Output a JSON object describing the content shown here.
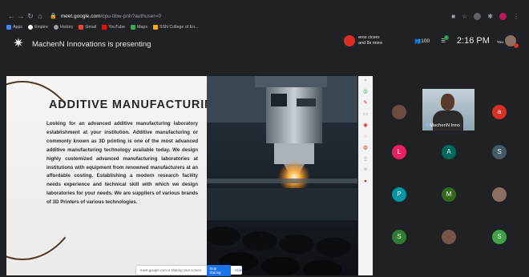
{
  "browser": {
    "nav_icons": [
      "back-icon",
      "forward-icon",
      "reload-icon",
      "home-icon"
    ],
    "url_host": "meet.google.com",
    "url_path": "/cpu-tibw-pnh?authuser=0",
    "bookmarks": [
      {
        "label": "Apps",
        "color": "#4285f4"
      },
      {
        "label": "Empire",
        "color": "#ffffff"
      },
      {
        "label": "History",
        "color": "#9aa0a6"
      },
      {
        "label": "Gmail",
        "color": "#ea4335"
      },
      {
        "label": "YouTube",
        "color": "#ff0000"
      },
      {
        "label": "Maps",
        "color": "#34a853"
      },
      {
        "label": "SSN College of En...",
        "color": "#f9ab00"
      }
    ]
  },
  "meet": {
    "presenting_text": "MachenN Innovations is presenting",
    "attendees_line1": "eros cicero",
    "attendees_line2": "and 8s more",
    "people_count": "100",
    "chat_badge": "1",
    "time": "2:16 PM",
    "you_label": "You"
  },
  "slide": {
    "title": "ADDITIVE MANUFACTURING",
    "body": "Looking for an advanced additive manufacturing laboratory establishment at your institution. Additive manufacturing or commonly known as 3D printing is one of the most advanced additive manufacturing technology available today. We design highly customized advanced manufacturing laboratories at institutions with equipment from renowned manufacturers at an affordable costing. Establishing a modern research facility needs experience and technical skill with which we design laboratories for your needs. We are suppliers of various brands of 3D Printers of various technologies."
  },
  "share_bar": {
    "text": "meet.google.com is sharing your screen.",
    "stop_label": "Stop sharing",
    "hide_label": "Hide"
  },
  "participants": {
    "video_name": "MachenN Inno",
    "tiles": [
      {
        "letter": "",
        "color": "#6d4c41"
      },
      {
        "letter": "a",
        "color": "#d93025"
      },
      {
        "letter": "L",
        "color": "#e91e63"
      },
      {
        "letter": "A",
        "color": "#00695c"
      },
      {
        "letter": "S",
        "color": "#455a64"
      },
      {
        "letter": "P",
        "color": "#0097a7"
      },
      {
        "letter": "M",
        "color": "#33691e"
      },
      {
        "letter": "",
        "color": "#8d6e63"
      },
      {
        "letter": "S",
        "color": "#2e7d32"
      },
      {
        "letter": "",
        "color": "#795548"
      },
      {
        "letter": "S",
        "color": "#43a047"
      }
    ]
  },
  "colors": {
    "meet_background": "#202124",
    "accent_blue": "#1a73e8",
    "slide_arc": "#4e3826"
  }
}
